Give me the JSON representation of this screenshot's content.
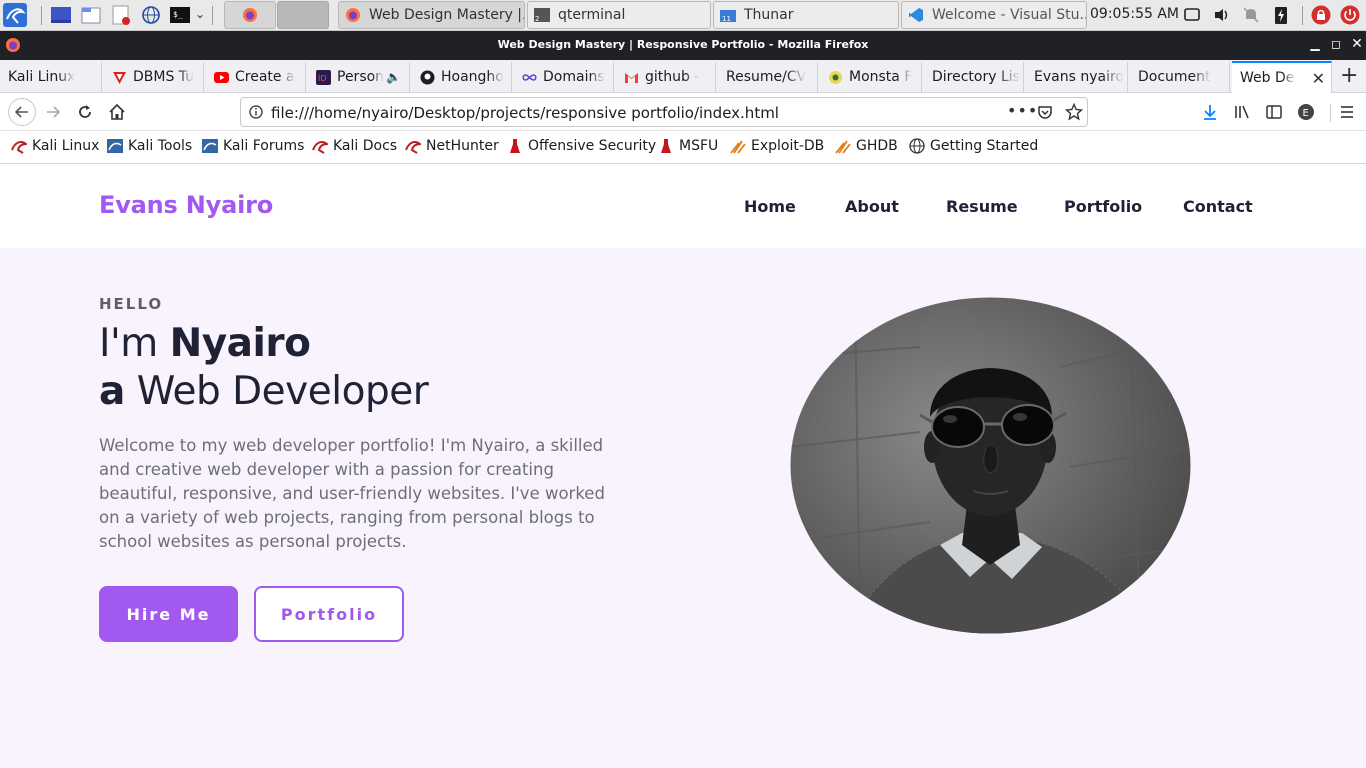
{
  "taskbar": {
    "tasks": [
      {
        "label": "Web Design Mastery |..."
      },
      {
        "label": "qterminal",
        "badge": "2"
      },
      {
        "label": "Thunar",
        "badge": "11"
      },
      {
        "label": "Welcome - Visual Stu..."
      }
    ],
    "clock": "09:05:55 AM"
  },
  "window": {
    "title": "Web Design Mastery | Responsive Portfolio - Mozilla Firefox"
  },
  "tabs": [
    {
      "label": "Kali Linux"
    },
    {
      "label": "DBMS Tu"
    },
    {
      "label": "Create a"
    },
    {
      "label": "Person"
    },
    {
      "label": "Hoangho"
    },
    {
      "label": "Domains"
    },
    {
      "label": "github -"
    },
    {
      "label": "Resume/CV"
    },
    {
      "label": "Monsta F"
    },
    {
      "label": "Directory Lis"
    },
    {
      "label": "Evans nyairo"
    },
    {
      "label": "Document"
    },
    {
      "label": "Web Desi"
    }
  ],
  "urlbar": {
    "url": "file:///home/nyairo/Desktop/projects/responsive portfolio/index.html"
  },
  "bookmarks": [
    {
      "label": "Kali Linux"
    },
    {
      "label": "Kali Tools"
    },
    {
      "label": "Kali Forums"
    },
    {
      "label": "Kali Docs"
    },
    {
      "label": "NetHunter"
    },
    {
      "label": "Offensive Security"
    },
    {
      "label": "MSFU"
    },
    {
      "label": "Exploit-DB"
    },
    {
      "label": "GHDB"
    },
    {
      "label": "Getting Started"
    }
  ],
  "site": {
    "logo": "Evans Nyairo",
    "nav": [
      "Home",
      "About",
      "Resume",
      "Portfolio",
      "Contact"
    ],
    "hero": {
      "greeting": "HELLO",
      "line1_prefix": "I'm ",
      "line1_name": "Nyairo",
      "line2_prefix": "a",
      "line2_role": " Web Developer",
      "description": "Welcome to my web developer portfolio! I'm Nyairo, a skilled and creative web developer with a passion for creating beautiful, responsive, and user-friendly websites. I've worked on a variety of web projects, ranging from personal blogs to school websites as personal projects.",
      "primary_button": "Hire Me",
      "secondary_button": "Portfolio"
    }
  },
  "colors": {
    "accent": "#a259f0",
    "heading": "#1f2235",
    "page_bg": "#f9f3fd"
  }
}
